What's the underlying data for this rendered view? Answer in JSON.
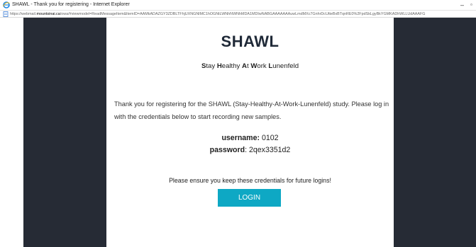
{
  "window": {
    "title": "SHAWL - Thank you for registering - Internet Explorer",
    "minimize_glyph": "–",
    "maximize_glyph": "▫",
    "app_icon": "internet-explorer-icon"
  },
  "addressbar": {
    "url_prefix": "https://webmail.",
    "url_domain": "mountsinai.ca",
    "url_rest": "/owa/#viewmodel=ReadMessageItem&ItemID=AAMkADAZGY3ZDBLTFhjUXNGNlMC1hOGNtLWNhNWNhMDA1MDIwNABGAAAAAAAuwLmdMXc7GnhrDcUtteBxBTqnRE0%2FpdSkLgyBkYGMKADhWLLUdAAAFG",
    "site_icon": "page-icon"
  },
  "email": {
    "logo": "SHAWL",
    "subtitle_parts": [
      "S",
      "tay ",
      "H",
      "ealthy ",
      "A",
      "t ",
      "W",
      "ork ",
      "L",
      "unenfeld"
    ],
    "message": "Thank you for registering for the SHAWL (Stay-Healthy-At-Work-Lunenfeld) study. Please log in with the credentials below to start recording new samples.",
    "username_label": "username:",
    "username_value": "0102",
    "password_label": "password",
    "password_value": ": 2qex3351d2",
    "note": "Please ensure you keep these credentials for future logins!",
    "login_label": "LOGIN"
  },
  "colors": {
    "sidebar": "#262b35",
    "button": "#0ea8c4",
    "logo": "#1f2937"
  }
}
